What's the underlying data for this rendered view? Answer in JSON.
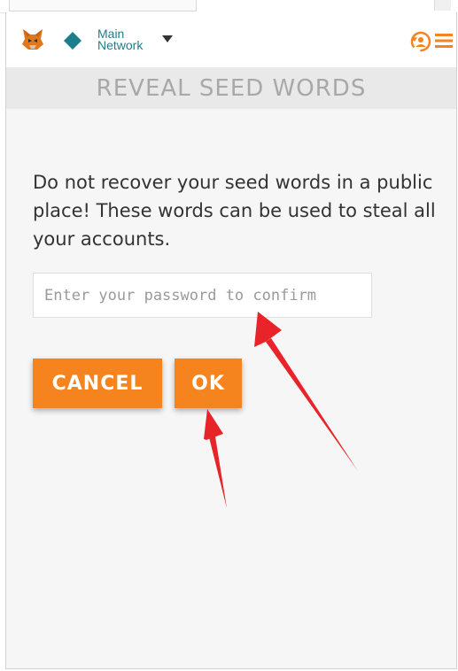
{
  "header": {
    "network_line1": "Main",
    "network_line2": "Network",
    "icons": {
      "logo": "metamask-fox-icon",
      "network": "diamond-icon",
      "dropdown": "caret-down-icon",
      "account": "account-icon",
      "menu": "hamburger-menu-icon"
    }
  },
  "page": {
    "title": "REVEAL SEED WORDS",
    "warning": "Do not recover your seed words in a public place! These words can be used to steal all your accounts."
  },
  "form": {
    "password_placeholder": "Enter your password to confirm",
    "password_value": ""
  },
  "actions": {
    "cancel_label": "CANCEL",
    "ok_label": "OK"
  },
  "colors": {
    "accent": "#f5841f",
    "network": "#1c7e8c",
    "annotation": "#e8232a"
  }
}
